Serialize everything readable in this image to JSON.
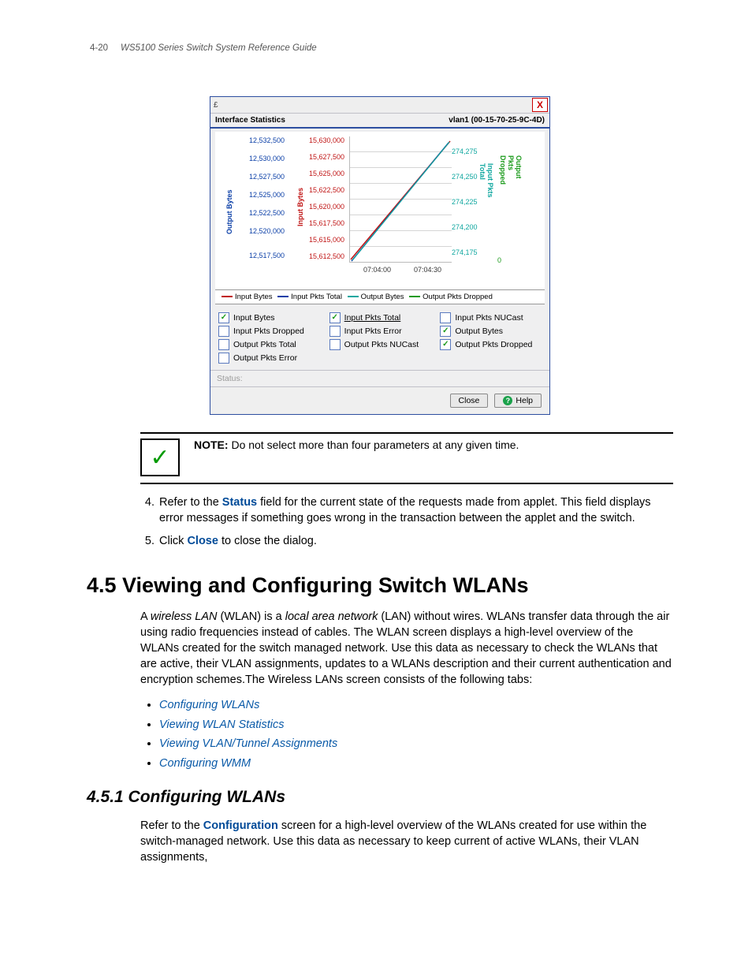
{
  "header": {
    "page_num": "4-20",
    "title": "WS5100 Series Switch System Reference Guide"
  },
  "dialog": {
    "java_label": "£",
    "close_x": "X",
    "panel_title_left": "Interface Statistics",
    "panel_title_right": "vlan1 (00-15-70-25-9C-4D)",
    "axis_labels": {
      "output_bytes": "Output Bytes",
      "input_bytes": "Input Bytes",
      "input_pkts_total": "Input Pkts Total",
      "output_pkts_dropped": "Output Pkts Dropped"
    },
    "legend_line": {
      "input_bytes": "Input Bytes",
      "input_pkts_total": "Input Pkts Total",
      "output_bytes": "Output Bytes",
      "output_pkts_dropped": "Output Pkts Dropped"
    },
    "checkboxes": [
      {
        "label": "Input Bytes",
        "checked": true
      },
      {
        "label": "Input Pkts Total",
        "checked": true,
        "underline": true
      },
      {
        "label": "Input Pkts NUCast",
        "checked": false
      },
      {
        "label": "Input Pkts Dropped",
        "checked": false
      },
      {
        "label": "Input Pkts Error",
        "checked": false
      },
      {
        "label": "Output Bytes",
        "checked": true
      },
      {
        "label": "Output Pkts Total",
        "checked": false
      },
      {
        "label": "Output Pkts NUCast",
        "checked": false
      },
      {
        "label": "Output Pkts Dropped",
        "checked": true
      },
      {
        "label": "Output Pkts Error",
        "checked": false
      }
    ],
    "status_label": "Status:",
    "buttons": {
      "close": "Close",
      "help": "Help"
    }
  },
  "chart_data": {
    "type": "line",
    "x_ticks": [
      "07:04:00",
      "07:04:30"
    ],
    "series": [
      {
        "name": "Output Bytes",
        "color": "#0b3fa7",
        "y_ticks": [
          12517500,
          12520000,
          12522500,
          12525000,
          12527500,
          12530000,
          12532500
        ],
        "y_tick_labels": [
          "12,517,500",
          "12,520,000",
          "12,522,500",
          "12,525,000",
          "12,527,500",
          "12,530,000",
          "12,532,500"
        ],
        "values_hint": "monotonic increasing"
      },
      {
        "name": "Input Bytes",
        "color": "#c01515",
        "y_ticks": [
          15612500,
          15615000,
          15617500,
          15620000,
          15622500,
          15625000,
          15627500,
          15630000
        ],
        "y_tick_labels": [
          "15,612,500",
          "15,615,000",
          "15,617,500",
          "15,620,000",
          "15,622,500",
          "15,625,000",
          "15,627,500",
          "15,630,000"
        ],
        "values_hint": "monotonic increasing"
      },
      {
        "name": "Input Pkts Total",
        "color": "#10a7a0",
        "y_ticks": [
          274175,
          274200,
          274225,
          274250,
          274275
        ],
        "y_tick_labels": [
          "274,175",
          "274,200",
          "274,225",
          "274,250",
          "274,275"
        ],
        "values_hint": "monotonic increasing"
      },
      {
        "name": "Output Pkts Dropped",
        "color": "#1a9a1a",
        "y_ticks": [
          0
        ],
        "y_tick_labels": [
          "0"
        ],
        "values_hint": "flat at 0"
      }
    ]
  },
  "note": {
    "label": "NOTE:",
    "text": " Do not select more than four parameters at any given time."
  },
  "steps": {
    "s4_a": "Refer to the ",
    "s4_kw": "Status",
    "s4_b": " field for the current state of the requests made from applet. This field displays error messages if something goes wrong in the transaction between the applet and the switch.",
    "s5_a": "Click ",
    "s5_kw": "Close",
    "s5_b": " to close the dialog."
  },
  "section_4_5": {
    "heading": "4.5 Viewing and Configuring Switch WLANs",
    "para_a": "A ",
    "para_i1": "wireless LAN",
    "para_b": " (WLAN) is a ",
    "para_i2": "local area network",
    "para_c": " (LAN) without wires. WLANs transfer data through the air using radio frequencies instead of cables. The WLAN screen displays a high-level overview of the WLANs created for the switch managed network. Use this data as necessary to check the WLANs that are active, their VLAN assignments, updates to a WLANs description and their current authentication and encryption schemes.The Wireless LANs screen consists of the following tabs:",
    "links": [
      "Configuring WLANs",
      "Viewing WLAN Statistics",
      "Viewing VLAN/Tunnel Assignments",
      "Configuring WMM"
    ]
  },
  "section_4_5_1": {
    "heading": "4.5.1 Configuring WLANs",
    "para_a": "Refer to the ",
    "para_kw": "Configuration",
    "para_b": " screen for a high-level overview of the WLANs created for use within the switch-managed network. Use this data as necessary to keep current of active WLANs, their VLAN assignments,"
  }
}
